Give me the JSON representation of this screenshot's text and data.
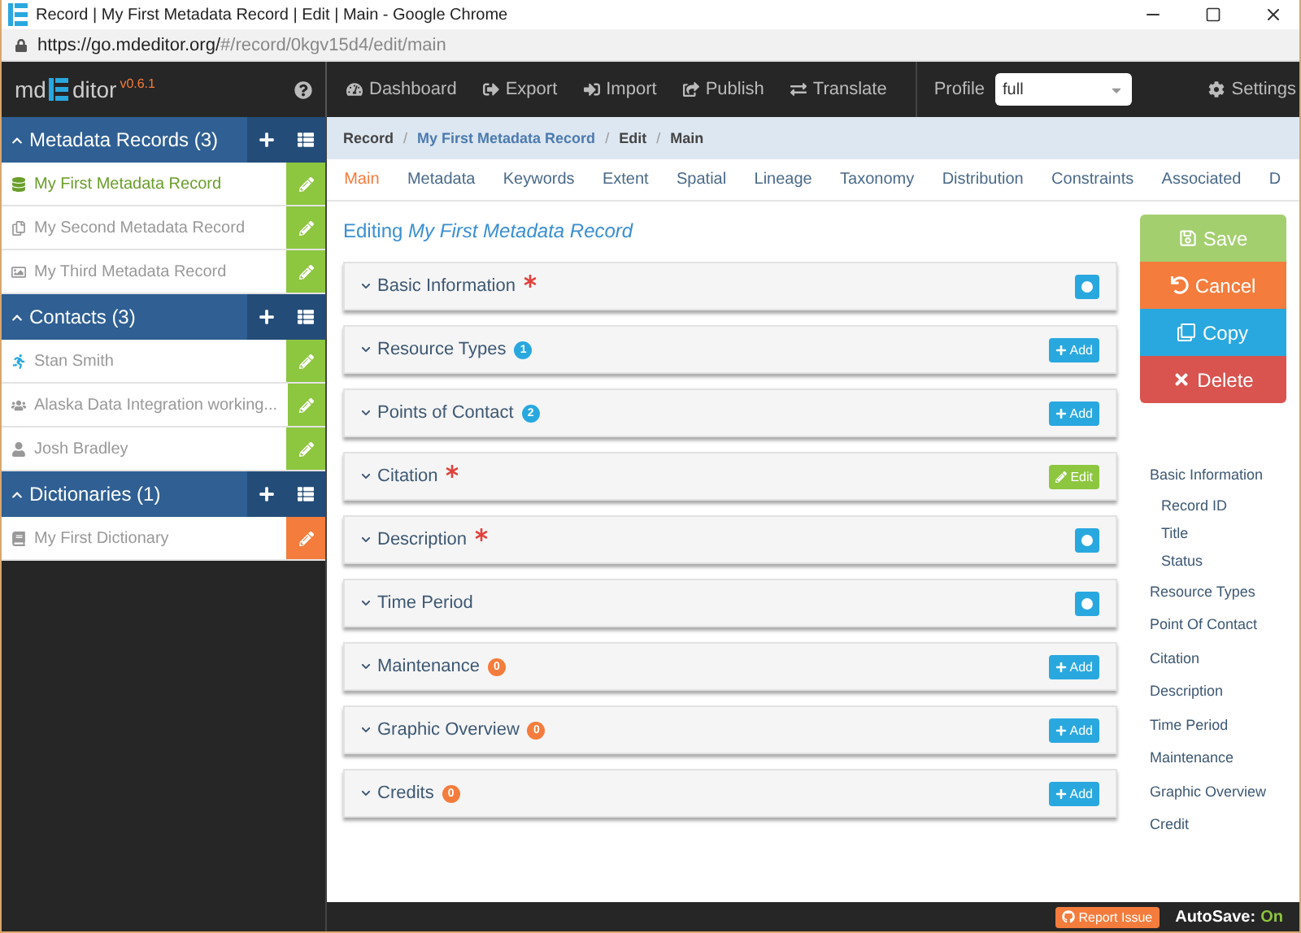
{
  "browser": {
    "title": "Record | My First Metadata Record | Edit | Main - Google Chrome",
    "url_host": "https://go.mdeditor.org/",
    "url_path": "#/record/0kgv15d4/edit/main"
  },
  "logo": {
    "prefix": "md",
    "suffix": "ditor",
    "version": "v0.6.1"
  },
  "toolbar": {
    "items": [
      "Dashboard",
      "Export",
      "Import",
      "Publish",
      "Translate"
    ],
    "profile_label": "Profile",
    "profile_value": "full",
    "settings": "Settings"
  },
  "sidebar": {
    "groups": [
      {
        "title": "Metadata Records (3)",
        "expanded": true,
        "color": "#8dc63f",
        "items": [
          {
            "label": "My First Metadata Record",
            "selected": true
          },
          {
            "label": "My Second Metadata Record",
            "selected": false
          },
          {
            "label": "My Third Metadata Record",
            "selected": false
          }
        ]
      },
      {
        "title": "Contacts (3)",
        "expanded": true,
        "color": "#8dc63f",
        "items": [
          {
            "label": "Stan Smith",
            "selected": false
          },
          {
            "label": "Alaska Data Integration working...",
            "selected": false
          },
          {
            "label": "Josh Bradley",
            "selected": false
          }
        ]
      },
      {
        "title": "Dictionaries (1)",
        "expanded": true,
        "color": "#f47c3c",
        "items": [
          {
            "label": "My First Dictionary",
            "selected": false
          }
        ]
      }
    ]
  },
  "breadcrumb": {
    "separator": "/",
    "items": [
      {
        "label": "Record",
        "link": false
      },
      {
        "label": "My First Metadata Record",
        "link": true
      },
      {
        "label": "Edit",
        "link": false
      },
      {
        "label": "Main",
        "link": false
      }
    ]
  },
  "tabs": [
    {
      "label": "Main",
      "selected": true
    },
    {
      "label": "Metadata",
      "selected": false
    },
    {
      "label": "Keywords",
      "selected": false
    },
    {
      "label": "Extent",
      "selected": false
    },
    {
      "label": "Spatial",
      "selected": false
    },
    {
      "label": "Lineage",
      "selected": false
    },
    {
      "label": "Taxonomy",
      "selected": false
    },
    {
      "label": "Distribution",
      "selected": false
    },
    {
      "label": "Constraints",
      "selected": false
    },
    {
      "label": "Associated",
      "selected": false
    },
    {
      "label": "D",
      "selected": false
    }
  ],
  "heading": {
    "prefix": "Editing",
    "record": "My First Metadata Record"
  },
  "sections": [
    {
      "title": "Basic Information",
      "required": true,
      "action": {
        "kind": "toggle"
      }
    },
    {
      "title": "Resource Types",
      "required": false,
      "badge": {
        "text": "1",
        "color": "#29a8df"
      },
      "action": {
        "kind": "add",
        "label": "Add"
      }
    },
    {
      "title": "Points of Contact",
      "required": false,
      "badge": {
        "text": "2",
        "color": "#29a8df"
      },
      "action": {
        "kind": "add",
        "label": "Add"
      }
    },
    {
      "title": "Citation",
      "required": true,
      "action": {
        "kind": "edit",
        "label": "Edit"
      }
    },
    {
      "title": "Description",
      "required": true,
      "action": {
        "kind": "toggle"
      }
    },
    {
      "title": "Time Period",
      "required": false,
      "action": {
        "kind": "toggle"
      }
    },
    {
      "title": "Maintenance",
      "required": false,
      "badge": {
        "text": "0",
        "color": "#f47c3c"
      },
      "action": {
        "kind": "add",
        "label": "Add"
      }
    },
    {
      "title": "Graphic Overview",
      "required": false,
      "badge": {
        "text": "0",
        "color": "#f47c3c"
      },
      "action": {
        "kind": "add",
        "label": "Add"
      }
    },
    {
      "title": "Credits",
      "required": false,
      "badge": {
        "text": "0",
        "color": "#f47c3c"
      },
      "action": {
        "kind": "add",
        "label": "Add"
      }
    }
  ],
  "actions": [
    {
      "kind": "save",
      "label": "Save"
    },
    {
      "kind": "cancel",
      "label": "Cancel"
    },
    {
      "kind": "copy",
      "label": "Copy"
    },
    {
      "kind": "delete",
      "label": "Delete"
    }
  ],
  "nav": [
    {
      "label": "Basic Information",
      "children": [
        {
          "label": "Record ID"
        },
        {
          "label": "Title"
        },
        {
          "label": "Status"
        }
      ]
    },
    {
      "label": "Resource Types"
    },
    {
      "label": "Point Of Contact"
    },
    {
      "label": "Citation"
    },
    {
      "label": "Description"
    },
    {
      "label": "Time Period"
    },
    {
      "label": "Maintenance"
    },
    {
      "label": "Graphic Overview"
    },
    {
      "label": "Credit"
    }
  ],
  "footer": {
    "report": "Report Issue",
    "autosave_label": "AutoSave:",
    "autosave_value": "On",
    "autosave_on": true
  }
}
